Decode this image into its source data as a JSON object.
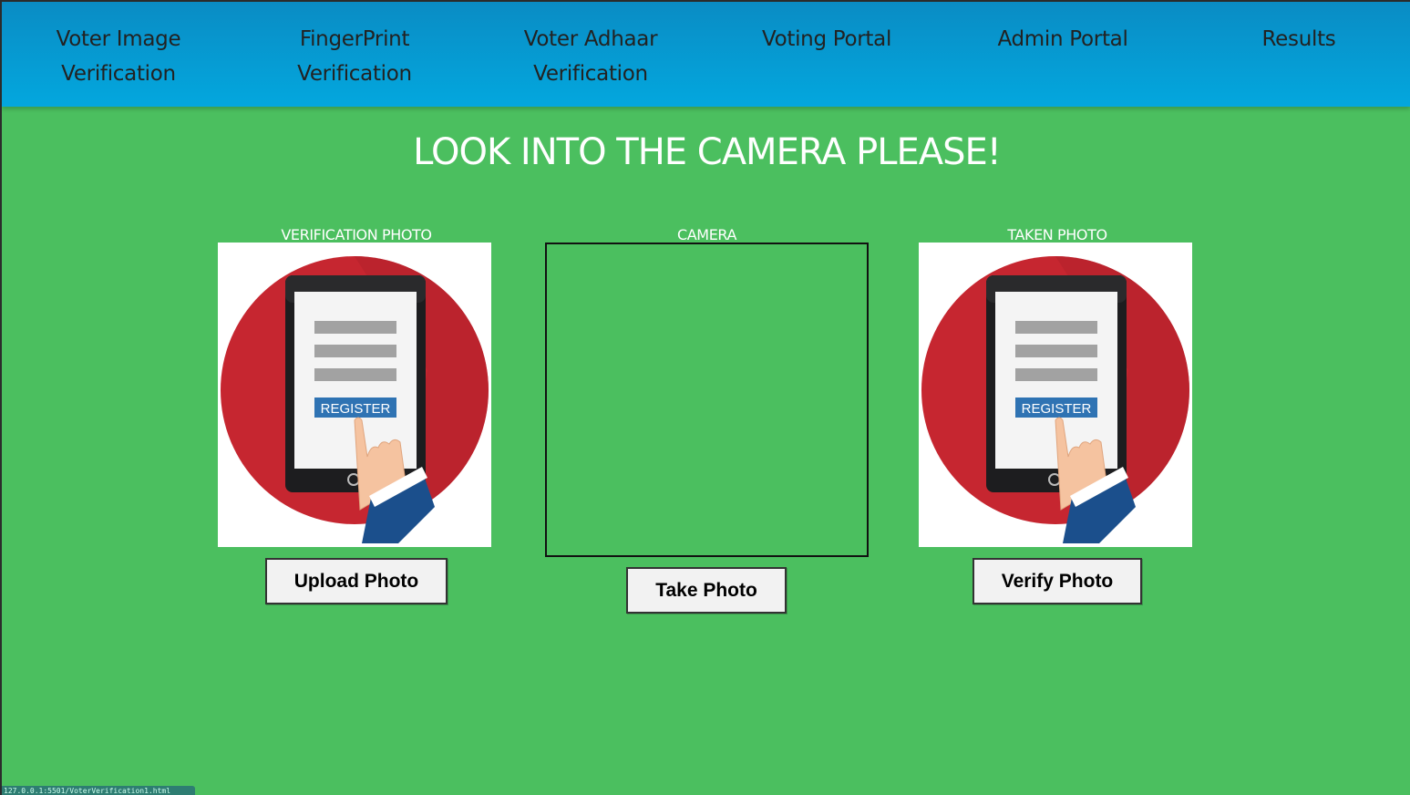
{
  "nav": {
    "items": [
      {
        "label": "Voter Image Verification"
      },
      {
        "label": "FingerPrint Verification"
      },
      {
        "label": "Voter Adhaar Verification"
      },
      {
        "label": "Voting Portal"
      },
      {
        "label": "Admin Portal"
      },
      {
        "label": "Results"
      }
    ]
  },
  "page": {
    "heading": "LOOK INTO THE CAMERA PLEASE!"
  },
  "panels": {
    "verification": {
      "label": "VERIFICATION PHOTO",
      "image_text": "REGISTER",
      "button": "Upload Photo"
    },
    "camera": {
      "label": "CAMERA",
      "button": "Take Photo"
    },
    "taken": {
      "label": "TAKEN PHOTO",
      "image_text": "REGISTER",
      "button": "Verify Photo"
    }
  },
  "status_bar": {
    "url": "127.0.0.1:5501/VoterVerification1.html"
  },
  "colors": {
    "page_bg": "#4bbf5f",
    "nav_top": "#0a8cc4",
    "nav_bottom": "#03a7de",
    "circle_red": "#c62630",
    "register_blue": "#2f73b3"
  }
}
